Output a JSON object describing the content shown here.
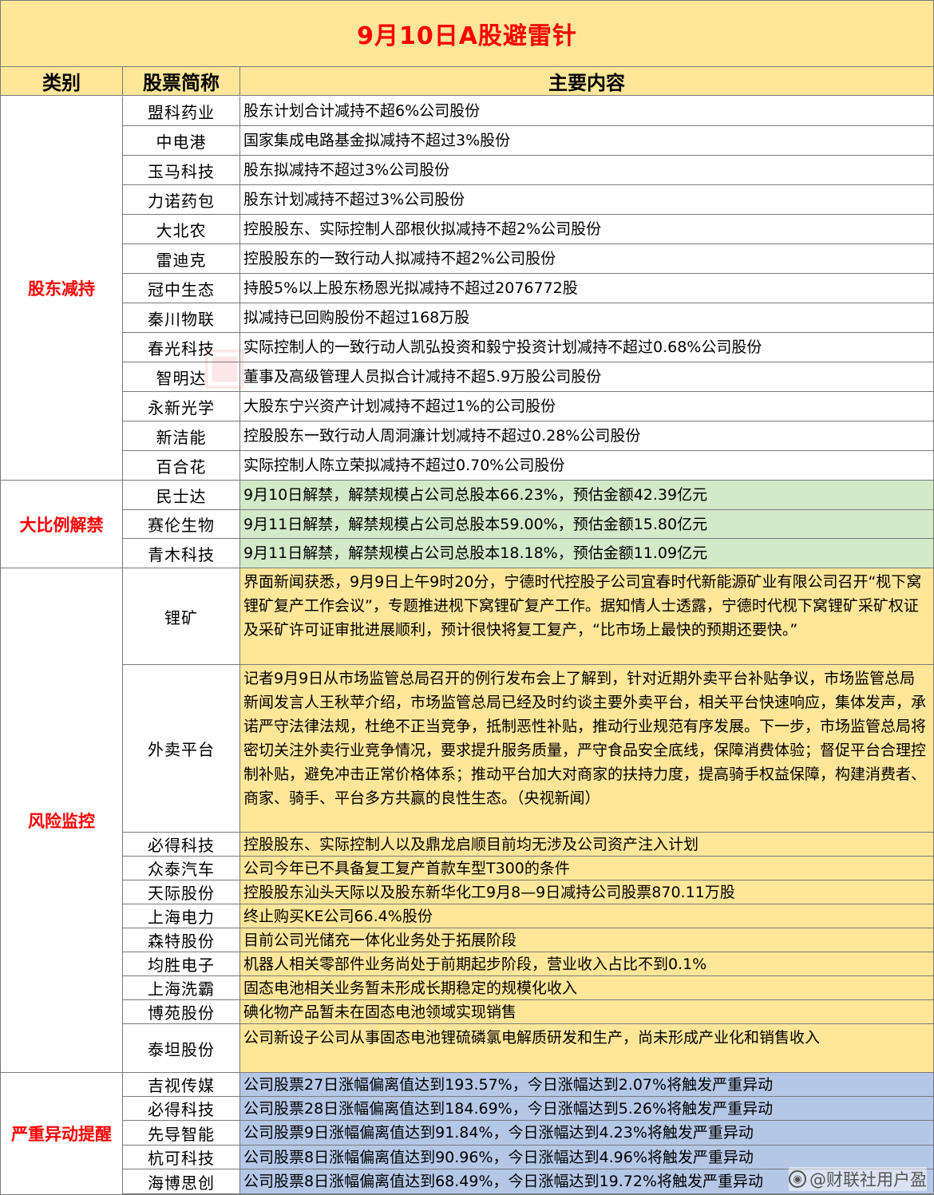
{
  "title": "9月10日A股避雷针",
  "headers": {
    "category": "类别",
    "name": "股票简称",
    "content": "主要内容"
  },
  "categories": {
    "reduce": "股东减持",
    "unlock": "大比例解禁",
    "risk": "风险监控",
    "abnormal": "严重异动提醒"
  },
  "reduce_rows": [
    {
      "name": "盟科药业",
      "content": "股东计划合计减持不超6%公司股份"
    },
    {
      "name": "中电港",
      "content": "国家集成电路基金拟减持不超过3%股份"
    },
    {
      "name": "玉马科技",
      "content": "股东拟减持不超过3%公司股份"
    },
    {
      "name": "力诺药包",
      "content": "股东计划减持不超过3%公司股份"
    },
    {
      "name": "大北农",
      "content": "控股股东、实际控制人邵根伙拟减持不超2%公司股份"
    },
    {
      "name": "雷迪克",
      "content": "控股股东的一致行动人拟减持不超2%公司股份"
    },
    {
      "name": "冠中生态",
      "content": "持股5%以上股东杨恩光拟减持不超过2076772股"
    },
    {
      "name": "秦川物联",
      "content": "拟减持已回购股份不超过168万股"
    },
    {
      "name": "春光科技",
      "content": "实际控制人的一致行动人凯弘投资和毅宁投资计划减持不超过0.68%公司股份"
    },
    {
      "name": "智明达",
      "content": "董事及高级管理人员拟合计减持不超5.9万股公司股份"
    },
    {
      "name": "永新光学",
      "content": "大股东宁兴资产计划减持不超过1%的公司股份"
    },
    {
      "name": "新洁能",
      "content": "控股股东一致行动人周洞濂计划减持不超过0.28%公司股份"
    },
    {
      "name": "百合花",
      "content": "实际控制人陈立荣拟减持不超过0.70%公司股份"
    }
  ],
  "unlock_rows": [
    {
      "name": "民士达",
      "content": "9月10日解禁，解禁规模占公司总股本66.23%，预估金额42.39亿元"
    },
    {
      "name": "赛伦生物",
      "content": "9月11日解禁，解禁规模占公司总股本59.00%，预估金额15.80亿元"
    },
    {
      "name": "青木科技",
      "content": "9月11日解禁，解禁规模占公司总股本18.18%，预估金额11.09亿元"
    }
  ],
  "risk_rows": [
    {
      "name": "锂矿",
      "content": "界面新闻获悉，9月9日上午9时20分，宁德时代控股子公司宜春时代新能源矿业有限公司召开“枧下窝锂矿复产工作会议”，专题推进枧下窝锂矿复产工作。据知情人士透露，宁德时代枧下窝锂矿采矿权证及采矿许可证审批进展顺利，预计很快将复工复产，“比市场上最快的预期还要快。”"
    },
    {
      "name": "外卖平台",
      "content": "记者9月9日从市场监管总局召开的例行发布会上了解到，针对近期外卖平台补贴争议，市场监管总局新闻发言人王秋苹介绍，市场监管总局已经及时约谈主要外卖平台，相关平台快速响应，集体发声，承诺严守法律法规，杜绝不正当竞争，抵制恶性补贴，推动行业规范有序发展。下一步，市场监管总局将密切关注外卖行业竞争情况，要求提升服务质量，严守食品安全底线，保障消费体验；督促平台合理控制补贴，避免冲击正常价格体系；推动平台加大对商家的扶持力度，提高骑手权益保障，构建消费者、商家、骑手、平台多方共赢的良性生态。（央视新闻）"
    },
    {
      "name": "必得科技",
      "content": "控股股东、实际控制人以及鼎龙启顺目前均无涉及公司资产注入计划"
    },
    {
      "name": "众泰汽车",
      "content": "公司今年已不具备复工复产首款车型T300的条件"
    },
    {
      "name": "天际股份",
      "content": "控股股东汕头天际以及股东新华化工9月8—9日减持公司股票870.11万股"
    },
    {
      "name": "上海电力",
      "content": "终止购买KE公司66.4%股份"
    },
    {
      "name": "森特股份",
      "content": "目前公司光储充一体化业务处于拓展阶段"
    },
    {
      "name": "均胜电子",
      "content": "机器人相关零部件业务尚处于前期起步阶段，营业收入占比不到0.1%"
    },
    {
      "name": "上海洗霸",
      "content": "固态电池相关业务暂未形成长期稳定的规模化收入"
    },
    {
      "name": "博苑股份",
      "content": "碘化物产品暂未在固态电池领域实现销售"
    },
    {
      "name": "泰坦股份",
      "content": "公司新设子公司从事固态电池锂硫磷氯电解质研发和生产，尚未形成产业化和销售收入"
    }
  ],
  "abnormal_rows": [
    {
      "name": "吉视传媒",
      "content": "公司股票27日涨幅偏离值达到193.57%，今日涨幅达到2.07%将触发严重异动"
    },
    {
      "name": "必得科技",
      "content": "公司股票28日涨幅偏离值达到184.69%，今日涨幅达到5.26%将触发严重异动"
    },
    {
      "name": "先导智能",
      "content": "公司股票9日涨幅偏离值达到91.84%，今日涨幅达到4.23%将触发严重异动"
    },
    {
      "name": "杭可科技",
      "content": "公司股票8日涨幅偏离值达到90.96%，今日涨幅达到4.96%将触发严重异动"
    },
    {
      "name": "海博思创",
      "content": "公司股票8日涨幅偏离值达到68.49%，今日涨幅达到19.72%将触发严重异动"
    }
  ],
  "watermark": {
    "icon": "weibo-icon",
    "text": "@财联社用户盈"
  },
  "colors": {
    "title_bg": "#ffe699",
    "title_text": "#ff0000",
    "unlock_bg": "#d3e9c8",
    "risk_bg": "#ffe699",
    "abnormal_bg": "#b4c7e7"
  }
}
